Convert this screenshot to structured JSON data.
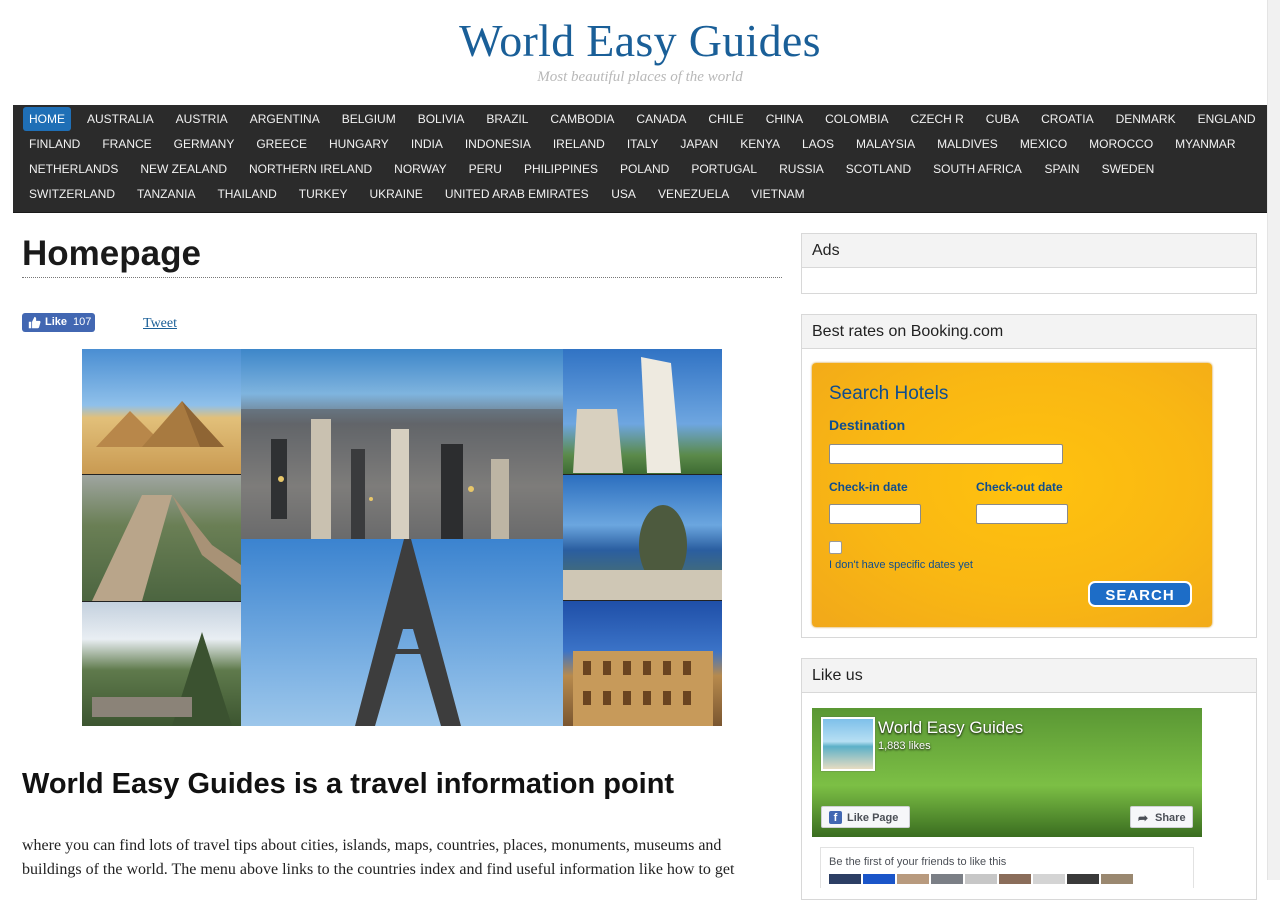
{
  "site": {
    "title": "World Easy Guides",
    "tagline": "Most beautiful places of the world"
  },
  "nav": {
    "active": "HOME",
    "rows": [
      [
        "HOME",
        "AUSTRALIA",
        "AUSTRIA",
        "ARGENTINA",
        "BELGIUM",
        "BOLIVIA",
        "BRAZIL",
        "CAMBODIA",
        "CANADA",
        "CHILE",
        "CHINA",
        "COLOMBIA",
        "CZECH R",
        "CUBA",
        "CROATIA",
        "DENMARK",
        "ENGLAND"
      ],
      [
        "FINLAND",
        "FRANCE",
        "GERMANY",
        "GREECE",
        "HUNGARY",
        "INDIA",
        "INDONESIA",
        "IRELAND",
        "ITALY",
        "JAPAN",
        "KENYA",
        "LAOS",
        "MALAYSIA",
        "MALDIVES",
        "MEXICO",
        "MOROCCO",
        "MYANMAR"
      ],
      [
        "NETHERLANDS",
        "NEW ZEALAND",
        "NORTHERN IRELAND",
        "NORWAY",
        "PERU",
        "PHILIPPINES",
        "POLAND",
        "PORTUGAL",
        "RUSSIA",
        "SCOTLAND",
        "SOUTH AFRICA",
        "SPAIN",
        "SWEDEN"
      ],
      [
        "SWITZERLAND",
        "TANZANIA",
        "THAILAND",
        "TURKEY",
        "UKRAINE",
        "UNITED ARAB EMIRATES",
        "USA",
        "VENEZUELA",
        "VIETNAM"
      ]
    ]
  },
  "main": {
    "page_title": "Homepage",
    "fb_like_label": "Like",
    "fb_like_count": "107",
    "tweet_label": "Tweet",
    "heading": "World Easy Guides is a travel information point",
    "intro": "where you can find lots of travel tips about cities, islands, maps, countries, places, monuments, museums and buildings of the world. The menu above links to the countries index and find useful information like how to get"
  },
  "sidebar": {
    "ads": {
      "title": "Ads"
    },
    "booking": {
      "title": "Best rates on Booking.com",
      "search_title": "Search Hotels",
      "destination_label": "Destination",
      "destination_value": "",
      "checkin_label": "Check-in date",
      "checkin_value": "",
      "checkout_label": "Check-out date",
      "checkout_value": "",
      "no_dates_checked": false,
      "no_dates_label": "I don't have specific dates yet",
      "search_button": "SEARCH"
    },
    "likeus": {
      "title": "Like us",
      "page_name": "World Easy Guides",
      "likes": "1,883 likes",
      "like_page_button": "Like Page",
      "share_button": "Share",
      "friends_text": "Be the first of your friends to like this"
    }
  },
  "colors": {
    "brand": "#1a5f98",
    "nav_bg": "#2b2b2b",
    "nav_active": "#1f6fb6",
    "booking_bg": "#ffc20e",
    "booking_text": "#0e4d8f",
    "search_button": "#1d6dc7"
  },
  "icons": {
    "fb_like": "thumbs-up-icon",
    "fb_logo": "facebook-icon",
    "share": "share-arrow-icon",
    "checkbox": "checkbox-icon"
  }
}
